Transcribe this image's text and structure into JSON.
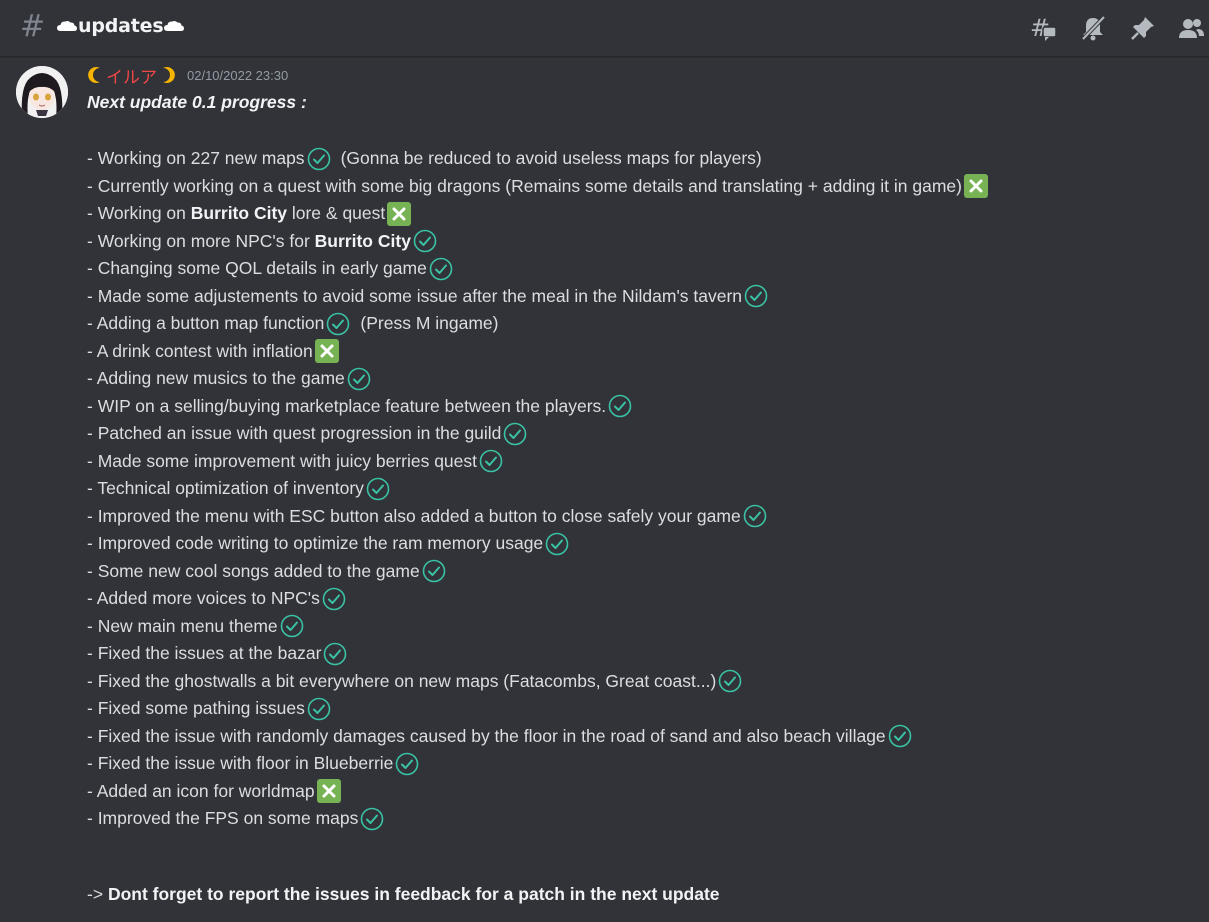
{
  "channel": {
    "name": "updates",
    "prefix_icon": "hash-icon",
    "decoration_icon": "cloud-icon"
  },
  "toolbar": {
    "icons": [
      "threads-icon",
      "mute-bell-icon",
      "pin-icon",
      "members-icon"
    ]
  },
  "message": {
    "username": "イルア",
    "username_color": "#f04747",
    "username_decoration_icon": "crescent-moon-icon",
    "timestamp": "02/10/2022 23:30",
    "heading": "Next update 0.1 progress :",
    "items": [
      {
        "prefix": "- Working on 227 new maps",
        "bold": "",
        "suffix": "",
        "status": "done",
        "extra": "(Gonna be reduced to avoid useless maps for players)"
      },
      {
        "prefix": "- Currently working on a quest with some big dragons (Remains some details and translating + adding it in game)",
        "bold": "",
        "suffix": "",
        "status": "todo",
        "extra": ""
      },
      {
        "prefix": "- Working on ",
        "bold": "Burrito City",
        "suffix": " lore & quest",
        "status": "todo",
        "extra": ""
      },
      {
        "prefix": "- Working on more NPC's for ",
        "bold": "Burrito City",
        "suffix": "",
        "status": "done",
        "extra": ""
      },
      {
        "prefix": "- Changing some QOL details in early game",
        "bold": "",
        "suffix": "",
        "status": "done",
        "extra": ""
      },
      {
        "prefix": "- Made some adjustements to avoid some issue after the meal in the Nildam's tavern",
        "bold": "",
        "suffix": "",
        "status": "done",
        "extra": ""
      },
      {
        "prefix": "- Adding a button map function",
        "bold": "",
        "suffix": "",
        "status": "done",
        "extra": "(Press M ingame)"
      },
      {
        "prefix": "- A drink contest with inflation",
        "bold": "",
        "suffix": "",
        "status": "todo",
        "extra": ""
      },
      {
        "prefix": "- Adding new musics to the game",
        "bold": "",
        "suffix": "",
        "status": "done",
        "extra": ""
      },
      {
        "prefix": "- WIP on a selling/buying marketplace feature between the players.",
        "bold": "",
        "suffix": "",
        "status": "done",
        "extra": ""
      },
      {
        "prefix": "- Patched an issue with quest progression in the guild",
        "bold": "",
        "suffix": "",
        "status": "done",
        "extra": ""
      },
      {
        "prefix": "- Made some improvement with juicy berries quest",
        "bold": "",
        "suffix": "",
        "status": "done",
        "extra": ""
      },
      {
        "prefix": "- Technical optimization of inventory",
        "bold": "",
        "suffix": "",
        "status": "done",
        "extra": ""
      },
      {
        "prefix": "- Improved the menu with ESC button also added a button to close safely your game",
        "bold": "",
        "suffix": "",
        "status": "done",
        "extra": ""
      },
      {
        "prefix": "- Improved code writing to optimize the ram memory usage",
        "bold": "",
        "suffix": "",
        "status": "done",
        "extra": ""
      },
      {
        "prefix": "- Some new cool songs added to the game",
        "bold": "",
        "suffix": "",
        "status": "done",
        "extra": ""
      },
      {
        "prefix": "- Added more voices to NPC's",
        "bold": "",
        "suffix": "",
        "status": "done",
        "extra": ""
      },
      {
        "prefix": "- New main menu theme",
        "bold": "",
        "suffix": "",
        "status": "done",
        "extra": ""
      },
      {
        "prefix": "- Fixed the issues at the bazar",
        "bold": "",
        "suffix": "",
        "status": "done",
        "extra": ""
      },
      {
        "prefix": "- Fixed the ghostwalls a bit everywhere on new maps (Fatacombs, Great coast...)",
        "bold": "",
        "suffix": "",
        "status": "done",
        "extra": ""
      },
      {
        "prefix": "- Fixed some pathing issues",
        "bold": "",
        "suffix": "",
        "status": "done",
        "extra": ""
      },
      {
        "prefix": "- Fixed the issue with randomly damages caused by the floor in the road of sand and also beach village",
        "bold": "",
        "suffix": "",
        "status": "done",
        "extra": ""
      },
      {
        "prefix": "- Fixed the issue with floor in Blueberrie",
        "bold": "",
        "suffix": "",
        "status": "done",
        "extra": ""
      },
      {
        "prefix": "- Added an icon for worldmap",
        "bold": "",
        "suffix": "",
        "status": "todo",
        "extra": ""
      },
      {
        "prefix": "- Improved the FPS on some maps",
        "bold": "",
        "suffix": "",
        "status": "done",
        "extra": ""
      }
    ],
    "footer_arrow": "->",
    "footer_text": "Dont forget to report the issues in feedback for a patch in the next update"
  },
  "colors": {
    "background": "#313338",
    "check": "#3ac2a4",
    "cross_bg": "#77b255",
    "text": "#dbdee1"
  }
}
